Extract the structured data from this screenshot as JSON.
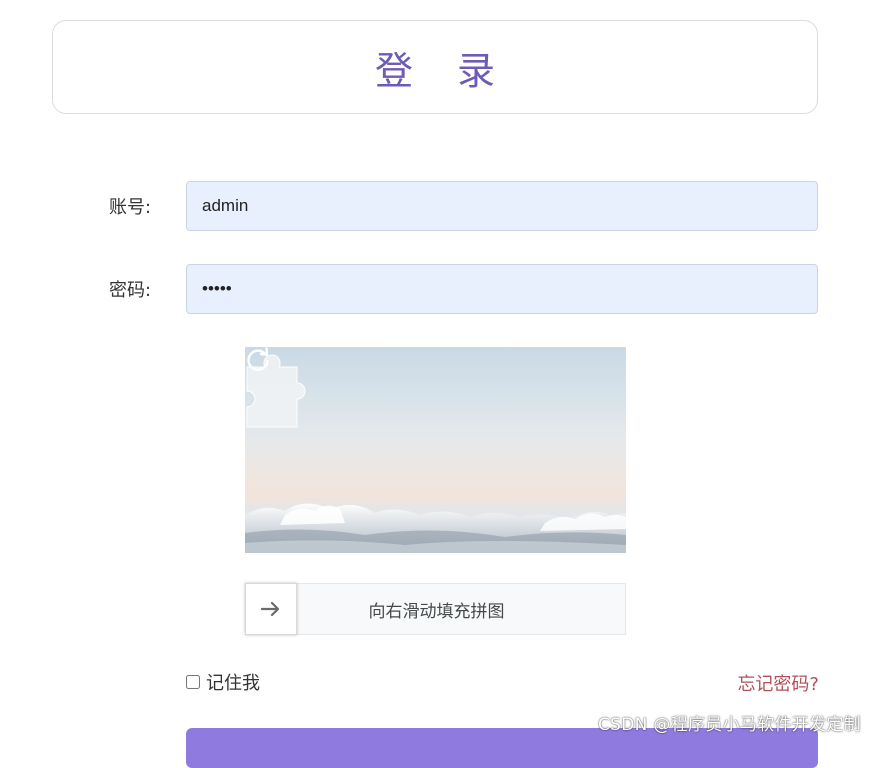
{
  "header": {
    "title": "登 录"
  },
  "form": {
    "account_label": "账号:",
    "account_value": "admin",
    "password_label": "密码:",
    "password_value": "•••••"
  },
  "captcha": {
    "slider_hint": "向右滑动填充拼图",
    "handle_icon": "arrow-right-icon",
    "refresh_icon": "refresh-icon",
    "slider_progress": 0
  },
  "options": {
    "remember_label": "记住我",
    "remember_checked": false,
    "forgot_label": "忘记密码?"
  },
  "actions": {
    "login_label": ""
  },
  "watermark": {
    "text": "CSDN @程序员小马软件开发定制"
  },
  "colors": {
    "title": "#6e5bb5",
    "input_bg": "#e8f0fe",
    "forgot_link": "#b0505c",
    "button": "#8f7be0"
  }
}
